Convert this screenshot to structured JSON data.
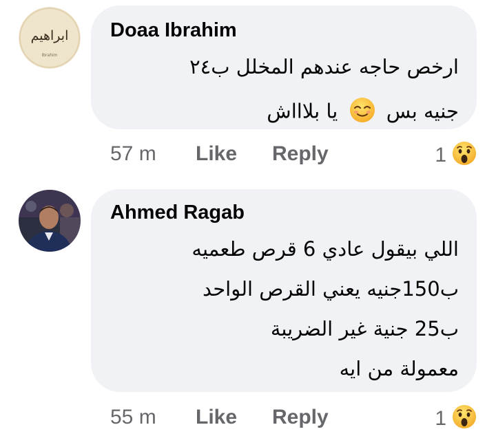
{
  "comments": [
    {
      "author": "Doaa Ibrahim",
      "avatar_text": "ابراهيم",
      "avatar_subtext": "Ibrahim",
      "lines": [
        "ارخص حاجه عندهم المخلل ب٢٤",
        "يا بلاااش",
        "جنيه بس"
      ],
      "inline_emoji": "relieved-smiling-face",
      "time": "57 m",
      "like_label": "Like",
      "reply_label": "Reply",
      "reaction_count": "1",
      "reaction_icon": "wow-reaction-icon"
    },
    {
      "author": "Ahmed Ragab",
      "lines": [
        "اللي بيقول عادي 6 قرص طعميه",
        "ب150جنيه يعني القرص الواحد",
        "ب25 جنية غير الضريبة",
        "معمولة من ايه"
      ],
      "time": "55 m",
      "like_label": "Like",
      "reply_label": "Reply",
      "reaction_count": "1",
      "reaction_icon": "wow-reaction-icon"
    }
  ],
  "colors": {
    "bubble": "#f0f2f5",
    "meta_text": "#65676b",
    "body_text": "#050505"
  }
}
